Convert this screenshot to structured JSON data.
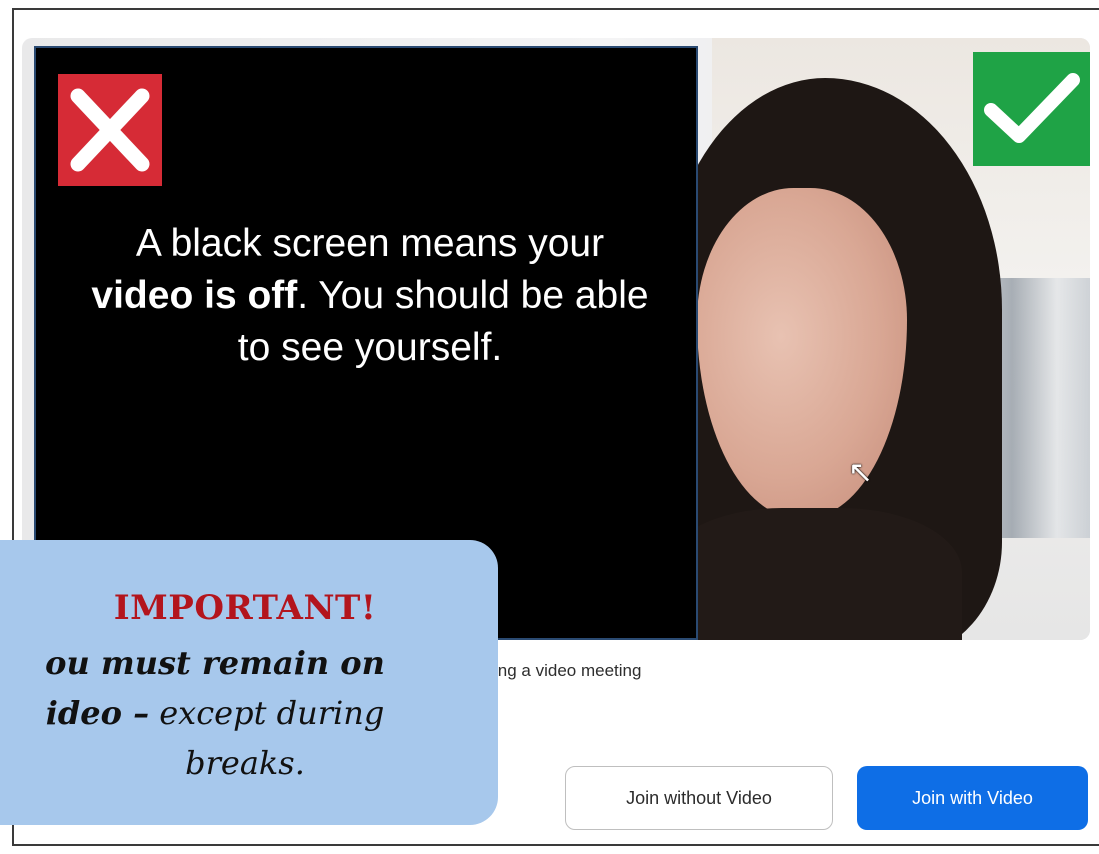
{
  "overlay": {
    "x_icon": "x-mark-icon",
    "check_icon": "check-mark-icon",
    "message_part1": "A black screen means your ",
    "message_bold1": "video is off",
    "message_part2": ". You should be able to see yourself.",
    "x_color": "#d62b36",
    "check_color": "#1fa346"
  },
  "video": {
    "caption": "ing a video meeting",
    "cursor_icon": "mouse-pointer-icon"
  },
  "buttons": {
    "join_without_video": "Join without Video",
    "join_with_video": "Join with Video",
    "primary_color": "#0e6ee6"
  },
  "important": {
    "title": "IMPORTANT!",
    "line1_bold": "ou must remain on",
    "line2_bold": "ideo –",
    "line2_rest": " except during",
    "line3": "breaks.",
    "title_color": "#b3151d",
    "box_color": "#a7c8ec"
  }
}
